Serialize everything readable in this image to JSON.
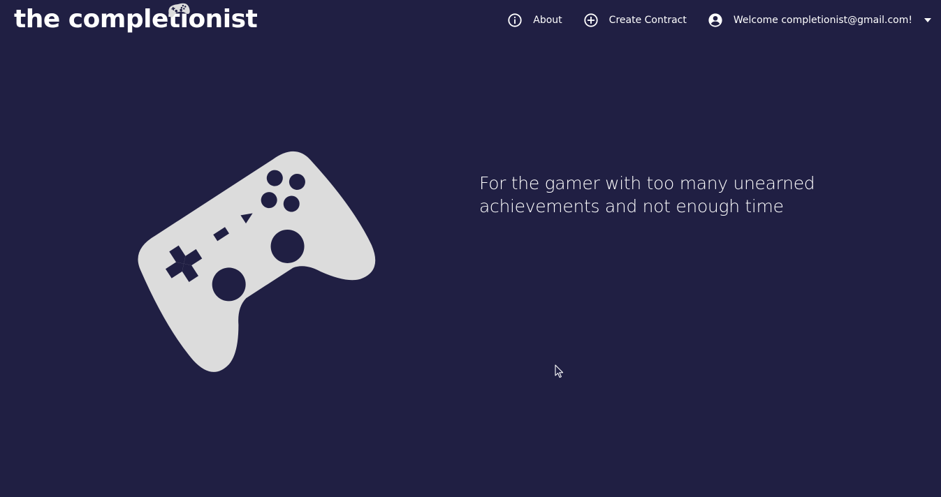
{
  "brand": {
    "title": "the completionist",
    "logo_icon": "gamepad-icon"
  },
  "nav": {
    "about": {
      "label": "About",
      "icon": "info-circle-icon"
    },
    "create_contract": {
      "label": "Create Contract",
      "icon": "plus-circle-icon"
    },
    "user": {
      "label": "Welcome completionist@gmail.com!",
      "icon": "account-circle-icon",
      "dropdown_icon": "caret-down-icon"
    }
  },
  "hero": {
    "graphic_icon": "gamepad-icon",
    "tagline": "For the gamer with too many unearned achievements and not enough time"
  },
  "colors": {
    "background": "#201f43",
    "text": "#ffffff",
    "controller_fill": "#dcdcdc"
  }
}
